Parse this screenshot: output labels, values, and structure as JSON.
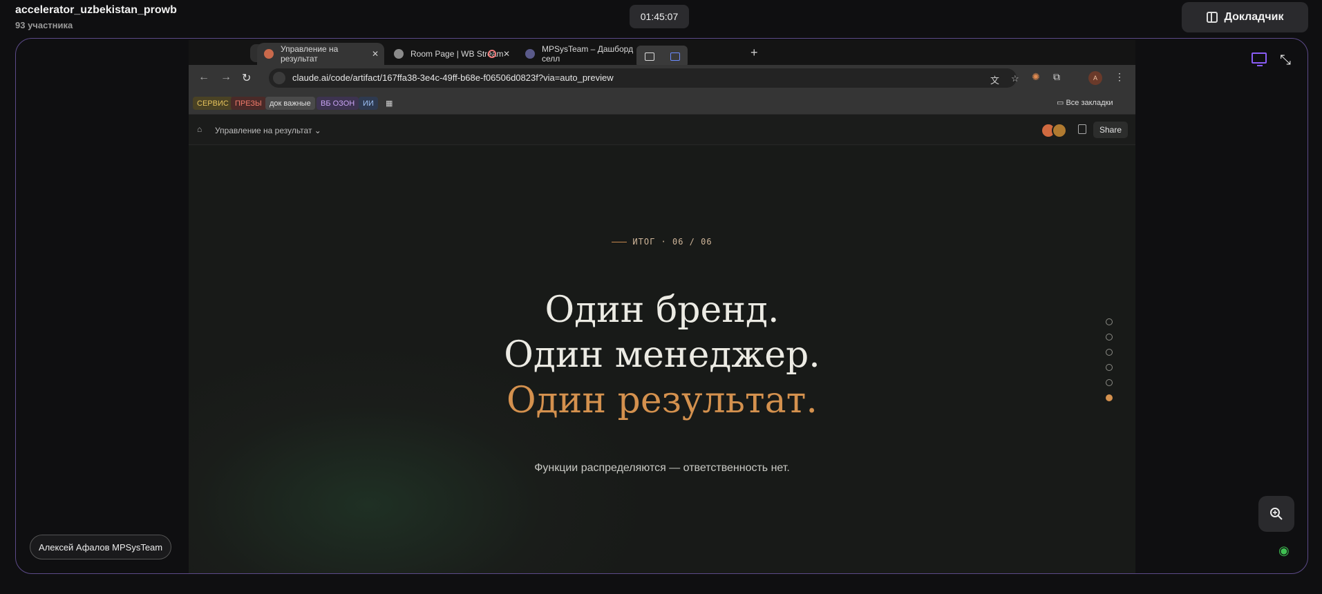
{
  "room": {
    "title": "accelerator_uzbekistan_prowb",
    "participants": "93 участника",
    "timer": "01:45:07",
    "speaker_button": "Докладчик",
    "presenter_name": "Алексей Афалов MPSysTeam"
  },
  "browser": {
    "tabs": [
      {
        "label": "Управление на результат",
        "active": true
      },
      {
        "label": "Room Page | WB Stream",
        "active": false
      },
      {
        "label": "MPSysTeam – Дашборд селл",
        "active": false
      }
    ],
    "url": "claude.ai/code/artifact/167ffa38-3e4c-49ff-b68e-f06506d0823f?via=auto_preview",
    "bookmarks": [
      {
        "label": "СЕРВИС",
        "color": "#e6c35c",
        "bg": "#4a4224"
      },
      {
        "label": "ПРЕЗЫ",
        "color": "#f07a6a",
        "bg": "#4a2a28"
      },
      {
        "label": "док важные",
        "color": "#e0e0e0",
        "bg": "#4a4a4a"
      },
      {
        "label": "ВБ ОЗОН",
        "color": "#c9a4f5",
        "bg": "#3d3350"
      },
      {
        "label": "ИИ",
        "color": "#9ec1f5",
        "bg": "#2e3a50"
      }
    ],
    "all_bookmarks": "Все закладки",
    "profile_initial": "A"
  },
  "artifact": {
    "title": "Управление на результат",
    "share_label": "Share"
  },
  "slide": {
    "kicker": "ИТОГ · 06 / 06",
    "line1": "Один бренд.",
    "line2": "Один менеджер.",
    "line3": "Один результат.",
    "subline": "Функции распределяются — ответственность нет.",
    "dot_count": 6,
    "active_dot": 6,
    "accent_color": "#d4914e"
  }
}
